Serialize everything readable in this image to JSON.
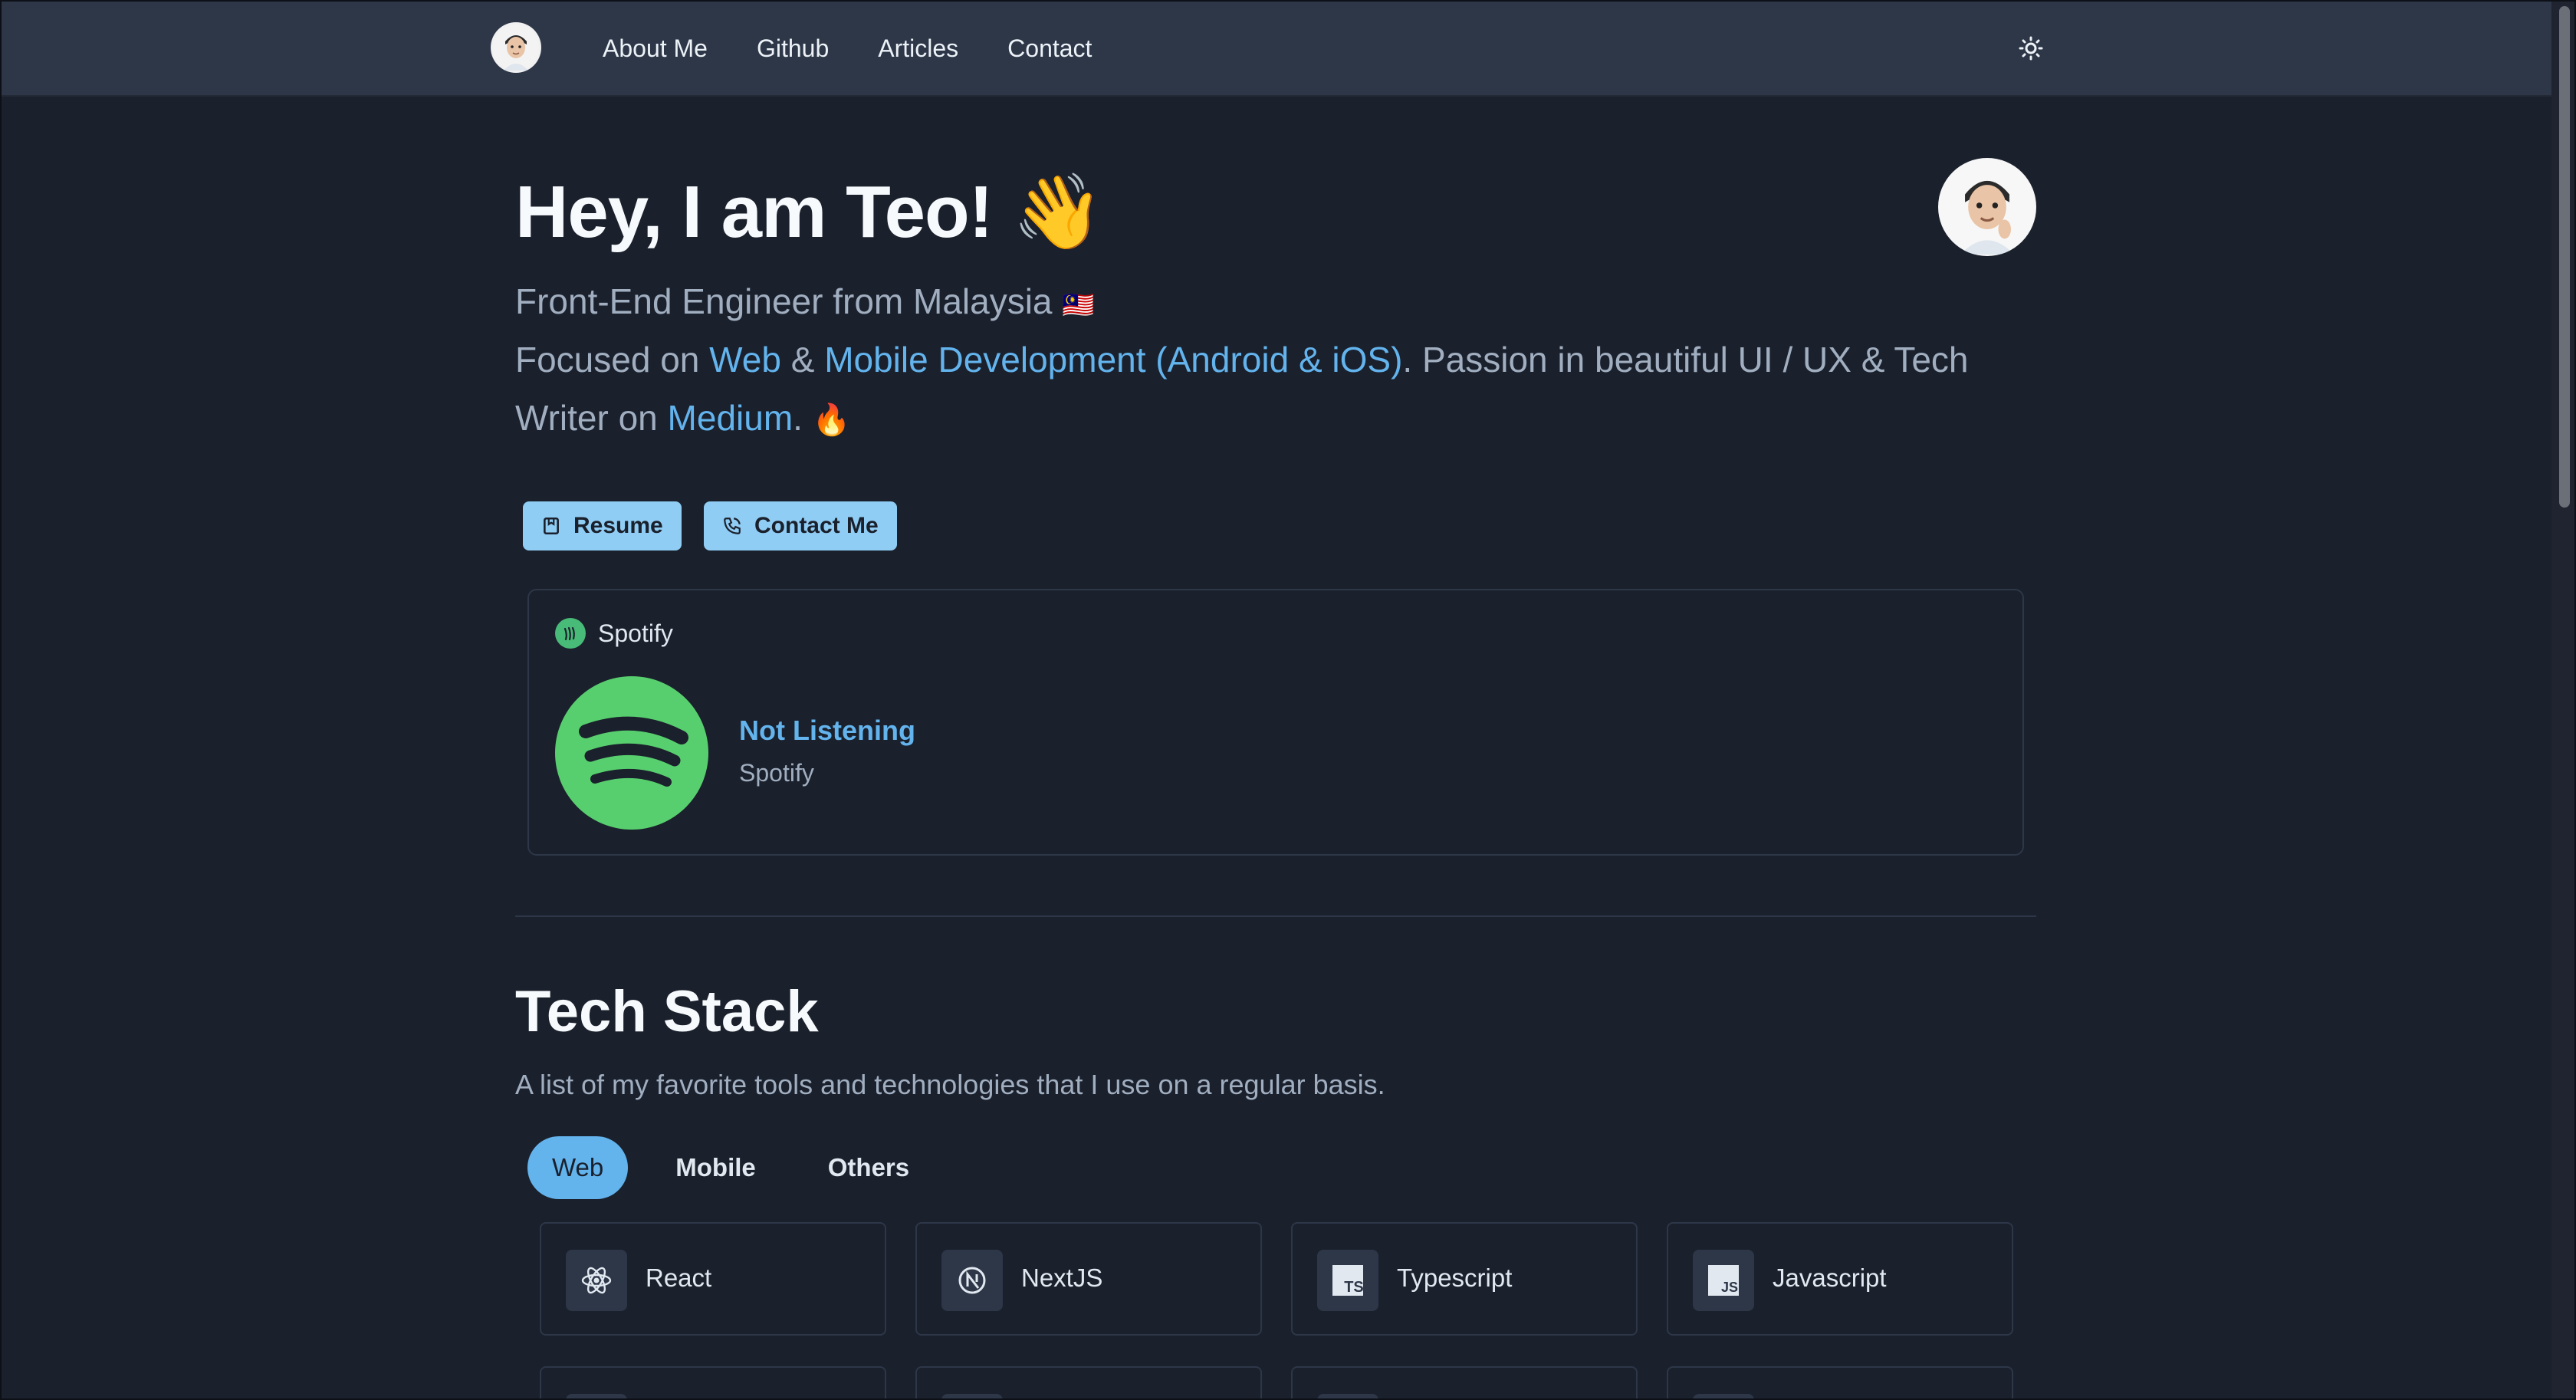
{
  "nav": {
    "links": [
      "About Me",
      "Github",
      "Articles",
      "Contact"
    ]
  },
  "hero": {
    "greeting": "Hey, I am Teo!",
    "greeting_emoji": "👋",
    "line1": "Front-End Engineer from Malaysia",
    "line1_flag": "🇲🇾",
    "line2_a": "Focused on ",
    "line2_web": "Web",
    "line2_b": " & ",
    "line2_mobile": "Mobile Development (Android & iOS)",
    "line2_c": ". Passion in beautiful UI / UX & Tech",
    "line3_a": "Writer on ",
    "line3_medium": "Medium",
    "line3_b": ".",
    "line3_emoji": "🔥",
    "resume_label": "Resume",
    "contact_label": "Contact Me"
  },
  "spotify": {
    "header": "Spotify",
    "status": "Not Listening",
    "source": "Spotify"
  },
  "tech_stack": {
    "title": "Tech Stack",
    "subtitle": "A list of my favorite tools and technologies that I use on a regular basis.",
    "tabs": [
      "Web",
      "Mobile",
      "Others"
    ],
    "active_tab": "Web",
    "items": [
      {
        "label": "React",
        "icon": "react-icon"
      },
      {
        "label": "NextJS",
        "icon": "nextjs-icon"
      },
      {
        "label": "Typescript",
        "icon": "typescript-icon"
      },
      {
        "label": "Javascript",
        "icon": "javascript-icon"
      }
    ]
  },
  "colors": {
    "background": "#1a202c",
    "nav": "#2d3748",
    "accent": "#63b3ed",
    "button": "#90cdf4",
    "spotify_green": "#58cf6e"
  }
}
